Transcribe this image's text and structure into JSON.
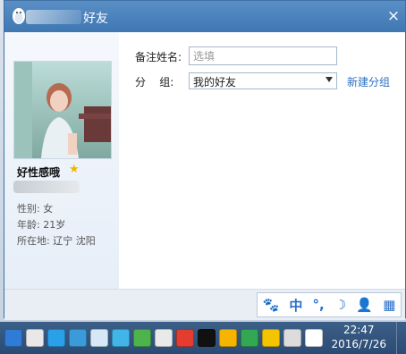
{
  "window": {
    "title": "好友",
    "close_symbol": "×"
  },
  "profile": {
    "nickname": "好性感哦",
    "star": "★",
    "gender": "性别: 女",
    "age": "年龄: 21岁",
    "location": "所在地: 辽宁  沈阳"
  },
  "form": {
    "remark_label": "备注姓名:",
    "remark_placeholder": "选填",
    "group_label": "分    组:",
    "group_value": "我的好友",
    "new_group_link": "新建分组"
  },
  "ime": {
    "items": [
      "🐾",
      "中",
      "°,",
      "☽",
      "👤",
      "▦"
    ]
  },
  "taskbar": {
    "time": "22:47",
    "date": "2016/7/26",
    "tray_colors": [
      "#2f7bd6",
      "#e8e8e8",
      "#2aa0e8",
      "#3b9bd8",
      "#d6e8f6",
      "#41b5e8",
      "#4db34d",
      "#e9e9e9",
      "#e43c2f",
      "#111111",
      "#f4b400",
      "#33a852",
      "#f5c400",
      "#dcdcdc",
      "#ffffff"
    ]
  }
}
